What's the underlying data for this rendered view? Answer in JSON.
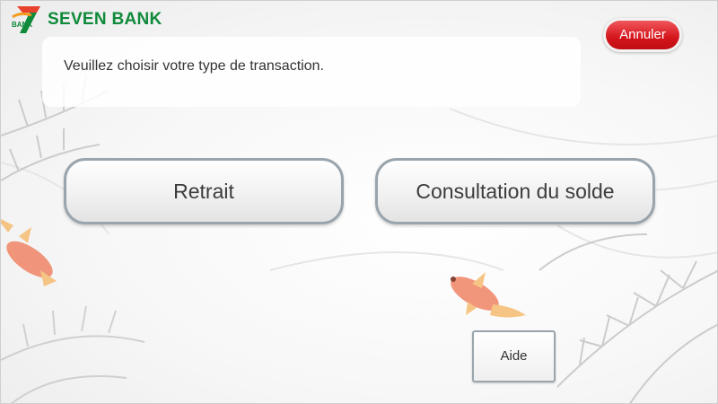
{
  "brand": {
    "name": "SEVEN BANK",
    "mark_text": "BANK",
    "primary_color": "#0f8a3a",
    "accent_color": "#e8412c"
  },
  "prompt": {
    "text": "Veuillez choisir votre type de transaction."
  },
  "buttons": {
    "cancel_label": "Annuler",
    "withdraw_label": "Retrait",
    "balance_label": "Consultation du solde",
    "help_label": "Aide"
  },
  "colors": {
    "cancel": "#d4151c",
    "button_border": "#9aa4ac",
    "fish": "#f08a6e"
  }
}
